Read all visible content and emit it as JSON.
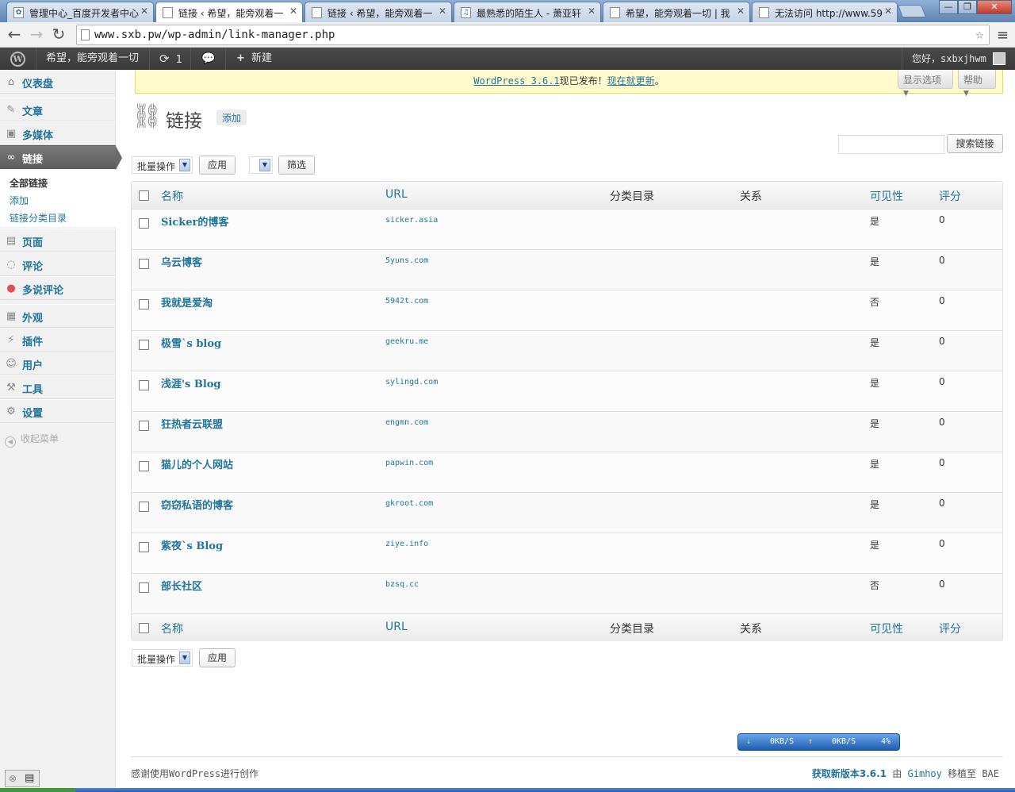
{
  "browser": {
    "tabs": [
      {
        "title": "管理中心_百度开发者中心",
        "active": false
      },
      {
        "title": "链接 ‹ 希望，能旁观着一",
        "active": true
      },
      {
        "title": "链接 ‹ 希望，能旁观着一",
        "active": false
      },
      {
        "title": "最熟悉的陌生人 - 萧亚轩",
        "active": false
      },
      {
        "title": "希望，能旁观着一切 | 我",
        "active": false
      },
      {
        "title": "无法访问 http://www.59",
        "active": false
      }
    ],
    "url": "www.sxb.pw/wp-admin/link-manager.php"
  },
  "adminbar": {
    "site_name": "希望，能旁观着一切",
    "updates_count": "1",
    "new_label": "新建",
    "greeting": "您好，sxbxjhwm"
  },
  "sidebar": {
    "items": [
      {
        "label": "仪表盘",
        "icon": "dashboard-icon"
      },
      {
        "label": "文章",
        "icon": "pin-icon"
      },
      {
        "label": "多媒体",
        "icon": "media-icon"
      },
      {
        "label": "链接",
        "icon": "link-icon"
      },
      {
        "label": "页面",
        "icon": "page-icon"
      },
      {
        "label": "评论",
        "icon": "comment-icon"
      },
      {
        "label": "多说评论",
        "icon": "duoshuo-icon"
      },
      {
        "label": "外观",
        "icon": "appearance-icon"
      },
      {
        "label": "插件",
        "icon": "plugin-icon"
      },
      {
        "label": "用户",
        "icon": "users-icon"
      },
      {
        "label": "工具",
        "icon": "tools-icon"
      },
      {
        "label": "设置",
        "icon": "settings-icon"
      }
    ],
    "submenu": [
      "全部链接",
      "添加",
      "链接分类目录"
    ],
    "collapse_label": "收起菜单"
  },
  "notice": {
    "link_text": "WordPress 3.6.1",
    "middle_text": "现已发布！",
    "update_text": "现在就更新",
    "end_text": "。"
  },
  "screen_meta": {
    "options_label": "显示选项",
    "help_label": "帮助"
  },
  "page": {
    "title": "链接",
    "add_new": "添加",
    "search_button": "搜索链接",
    "bulk_action": "批量操作",
    "apply": "应用",
    "filter": "筛选"
  },
  "table": {
    "columns": [
      "名称",
      "URL",
      "分类目录",
      "关系",
      "可见性",
      "评分"
    ],
    "rows": [
      {
        "name": "Sicker的博客",
        "url": "sicker.asia",
        "visible": "是",
        "rating": "0"
      },
      {
        "name": "乌云博客",
        "url": "5yuns.com",
        "visible": "是",
        "rating": "0"
      },
      {
        "name": "我就是爱淘",
        "url": "5942t.com",
        "visible": "否",
        "rating": "0"
      },
      {
        "name": "极雪`s blog",
        "url": "geekru.me",
        "visible": "是",
        "rating": "0"
      },
      {
        "name": "浅涯's Blog",
        "url": "sylingd.com",
        "visible": "是",
        "rating": "0"
      },
      {
        "name": "狂热者云联盟",
        "url": "engmn.com",
        "visible": "是",
        "rating": "0"
      },
      {
        "name": "猫儿的个人网站",
        "url": "papwin.com",
        "visible": "是",
        "rating": "0"
      },
      {
        "name": "窃窃私语的博客",
        "url": "gkroot.com",
        "visible": "是",
        "rating": "0"
      },
      {
        "name": "紫夜`s Blog",
        "url": "ziye.info",
        "visible": "是",
        "rating": "0"
      },
      {
        "name": "部长社区",
        "url": "bzsq.cc",
        "visible": "否",
        "rating": "0"
      }
    ]
  },
  "netmon": {
    "down": "0KB/S",
    "up": "0KB/S",
    "percent": "4%"
  },
  "footer": {
    "left_prefix": "感谢使用",
    "left_link": "WordPress",
    "left_suffix": "进行创作",
    "get_version": "获取新版本3.6.1",
    "by": " 由 ",
    "author": "Gimhoy",
    "ported": " 移植至 BAE"
  },
  "colors": {
    "link": "#21759b",
    "adminbar": "#464646",
    "notice_bg": "#fffbcc"
  }
}
